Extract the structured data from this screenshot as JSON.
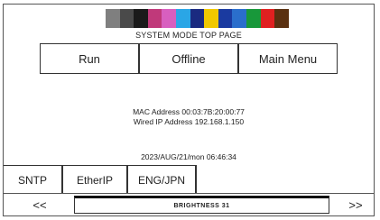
{
  "header": {
    "swatch_colors": [
      "#7f7f7f",
      "#4a4a4a",
      "#1a1a1a",
      "#c0397a",
      "#d85fbf",
      "#2aa6e6",
      "#1a2a80",
      "#f0c800",
      "#1a3aa0",
      "#2a6ecc",
      "#18983a",
      "#e02020",
      "#5a3010"
    ],
    "title": "SYSTEM MODE TOP PAGE"
  },
  "top_buttons": {
    "run": "Run",
    "offline": "Offline",
    "main_menu": "Main Menu"
  },
  "info": {
    "mac_line": "MAC Address  00:03:7B:20:00:77",
    "ip_line": "Wired IP Address  192.168.1.150"
  },
  "datetime": "2023/AUG/21/mon 06:46:34",
  "bottom_buttons": {
    "sntp": "SNTP",
    "etherip": "EtherIP",
    "lang": "ENG/JPN"
  },
  "nav": {
    "prev": "<<",
    "next": ">>",
    "brightness_label": "BRIGHTNESS 31"
  }
}
